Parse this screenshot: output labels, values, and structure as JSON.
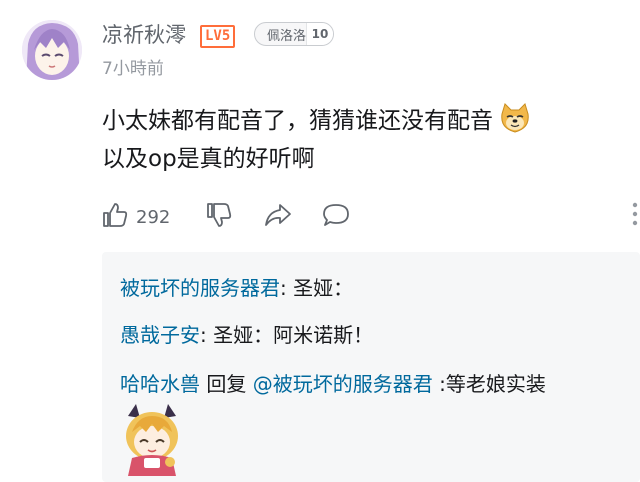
{
  "comment": {
    "username": "凉祈秋澪",
    "level_badge": "LV5",
    "medal_name": "佩洛洛",
    "medal_level": "10",
    "timestamp": "7小時前",
    "content_line1": "小太妹都有配音了，猜猜谁还没有配音",
    "content_line2": "以及op是真的好听啊",
    "emoji": "doge-emoji",
    "like_count": "292"
  },
  "icons": {
    "like": "thumbs-up-icon",
    "dislike": "thumbs-down-icon",
    "share": "share-icon",
    "reply": "reply-bubble-icon",
    "more": "more-vertical-icon"
  },
  "replies": [
    {
      "name": "被玩坏的服务器君",
      "separator": ": ",
      "text": "圣娅："
    },
    {
      "name": "愚哉子安",
      "separator": ": ",
      "text": "圣娅：阿米诺斯！"
    },
    {
      "name": "哈哈水兽",
      "reply_word": " 回复 ",
      "mention": "@被玩坏的服务器君",
      "text": " :等老娘实装"
    }
  ],
  "colors": {
    "username": "#61666d",
    "level": "#ff6d3a",
    "link": "#00699d",
    "reply_bg": "#f6f7f8"
  }
}
